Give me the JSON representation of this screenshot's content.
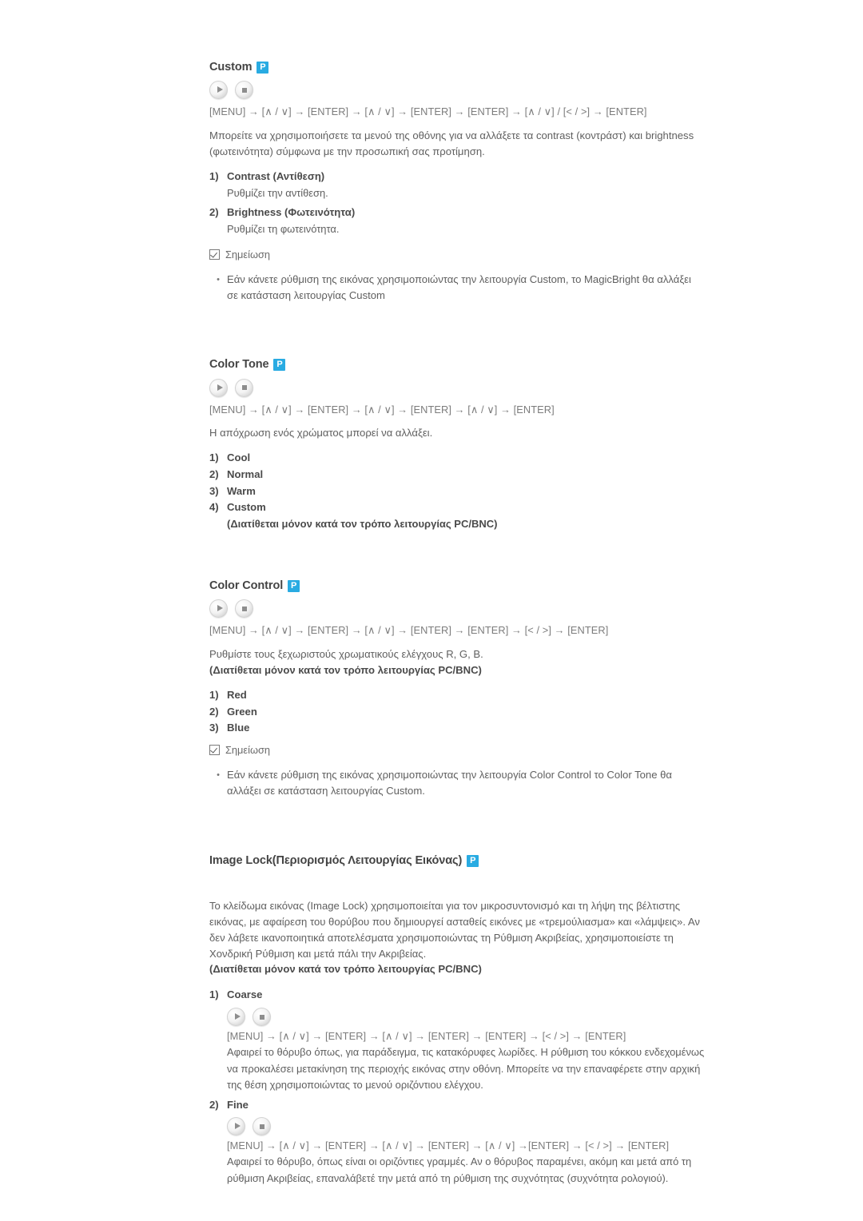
{
  "document": {
    "language": "el",
    "accent_color": "#29ABE2",
    "badge_glyph": "P"
  },
  "sections": [
    {
      "id": "custom",
      "heading": "Custom",
      "badge": "picture-badge-icon",
      "buttons": [
        {
          "name": "play-button",
          "glyph": "play-icon"
        },
        {
          "name": "stop-button",
          "glyph": "stop-icon"
        }
      ],
      "key_sequence": "[MENU] → [∧ / ∨] → [ENTER] → [∧ / ∨] → [ENTER] → [ENTER] → [∧ / ∨] / [< / >] → [ENTER]",
      "paragraph": "Μπορείτε να χρησιμοποιήσετε τα μενού της οθόνης για να αλλάξετε τα contrast (κοντράστ) και brightness (φωτεινότητα) σύμφωνα με την προσωπική σας προτίμηση.",
      "items": [
        {
          "num": "1)",
          "label": "Contrast (Αντίθεση)",
          "desc": "Ρυθμίζει την αντίθεση."
        },
        {
          "num": "2)",
          "label": "Brightness (Φωτεινότητα)",
          "desc": "Ρυθμίζει τη φωτεινότητα."
        }
      ],
      "note": {
        "title": "Σημείωση",
        "bullets": [
          "Εάν κάνετε ρύθμιση της εικόνας χρησιμοποιώντας την λειτουργία Custom, το MagicBright θα αλλάξει σε κατάσταση λειτουργίας Custom"
        ]
      }
    },
    {
      "id": "color-tone",
      "heading": "Color Tone",
      "badge": "picture-badge-icon",
      "buttons": [
        {
          "name": "play-button",
          "glyph": "play-icon"
        },
        {
          "name": "stop-button",
          "glyph": "stop-icon"
        }
      ],
      "key_sequence": "[MENU] → [∧ / ∨] → [ENTER] → [∧ / ∨] → [ENTER] → [∧ / ∨] → [ENTER]",
      "paragraph": "Η απόχρωση ενός χρώματος μπορεί να αλλάξει.",
      "items": [
        {
          "num": "1)",
          "label": "Cool"
        },
        {
          "num": "2)",
          "label": "Normal"
        },
        {
          "num": "3)",
          "label": "Warm"
        },
        {
          "num": "4)",
          "label": "Custom",
          "note": "(Διατίθεται μόνον κατά τον τρόπο λειτουργίας PC/BNC)"
        }
      ]
    },
    {
      "id": "color-control",
      "heading": "Color Control",
      "badge": "picture-badge-icon",
      "buttons": [
        {
          "name": "play-button",
          "glyph": "play-icon"
        },
        {
          "name": "stop-button",
          "glyph": "stop-icon"
        }
      ],
      "key_sequence": "[MENU] → [∧ / ∨] → [ENTER] → [∧ / ∨] → [ENTER] → [ENTER] → [< / >] → [ENTER]",
      "paragraph": "Ρυθμίστε τους ξεχωριστούς χρωματικούς ελέγχους R, G, B.",
      "paragraph_bold": "(Διατίθεται μόνον κατά τον τρόπο λειτουργίας PC/BNC)",
      "items": [
        {
          "num": "1)",
          "label": "Red"
        },
        {
          "num": "2)",
          "label": "Green"
        },
        {
          "num": "3)",
          "label": "Blue"
        }
      ],
      "note": {
        "title": "Σημείωση",
        "bullets": [
          "Εάν κάνετε ρύθμιση της εικόνας χρησιμοποιώντας την λειτουργία Color Control το Color Tone θα αλλάξει σε κατάσταση λειτουργίας Custom."
        ]
      }
    },
    {
      "id": "image-lock",
      "heading": "Image Lock(Περιορισμός Λειτουργίας Εικόνας)",
      "badge": "picture-badge-icon",
      "paragraph": "Το κλείδωμα εικόνας (Image Lock) χρησιμοποιείται για τον μικροσυντονισμό και τη λήψη της βέλτιστης εικόνας, με αφαίρεση του θορύβου που δημιουργεί ασταθείς εικόνες με «τρεμούλιασμα» και «λάμψεις». Αν δεν λάβετε ικανοποιητικά αποτελέσματα χρησιμοποιώντας τη Ρύθμιση Ακριβείας, χρησιμοποιείστε τη Χονδρική Ρύθμιση και μετά πάλι την Ακριβείας.",
      "paragraph_bold": "(Διατίθεται μόνον κατά τον τρόπο λειτουργίας PC/BNC)",
      "items": [
        {
          "num": "1)",
          "label": "Coarse",
          "buttons": [
            {
              "name": "play-button",
              "glyph": "play-icon"
            },
            {
              "name": "stop-button",
              "glyph": "stop-icon"
            }
          ],
          "key_sequence": "[MENU] → [∧ / ∨] → [ENTER] → [∧ / ∨] → [ENTER] → [ENTER] → [< / >] → [ENTER]",
          "desc": "Αφαιρεί το θόρυβο όπως, για παράδειγμα, τις κατακόρυφες λωρίδες. Η ρύθμιση του κόκκου ενδεχομένως να προκαλέσει μετακίνηση της περιοχής εικόνας στην οθόνη. Μπορείτε να την επαναφέρετε στην αρχική της θέση χρησιμοποιώντας το μενού οριζόντιου ελέγχου."
        },
        {
          "num": "2)",
          "label": "Fine",
          "buttons": [
            {
              "name": "play-button",
              "glyph": "play-icon"
            },
            {
              "name": "stop-button",
              "glyph": "stop-icon"
            }
          ],
          "key_sequence": "[MENU] → [∧ / ∨] → [ENTER] → [∧ / ∨] → [ENTER] → [∧ / ∨] →[ENTER] → [< / >] → [ENTER]",
          "desc": "Αφαιρεί το θόρυβο, όπως είναι οι οριζόντιες γραμμές. Αν ο θόρυβος παραμένει, ακόμη και μετά από τη ρύθμιση Ακριβείας, επαναλάβετέ την μετά από τη ρύθμιση της συχνότητας (συχνότητα ρολογιού)."
        }
      ]
    }
  ]
}
